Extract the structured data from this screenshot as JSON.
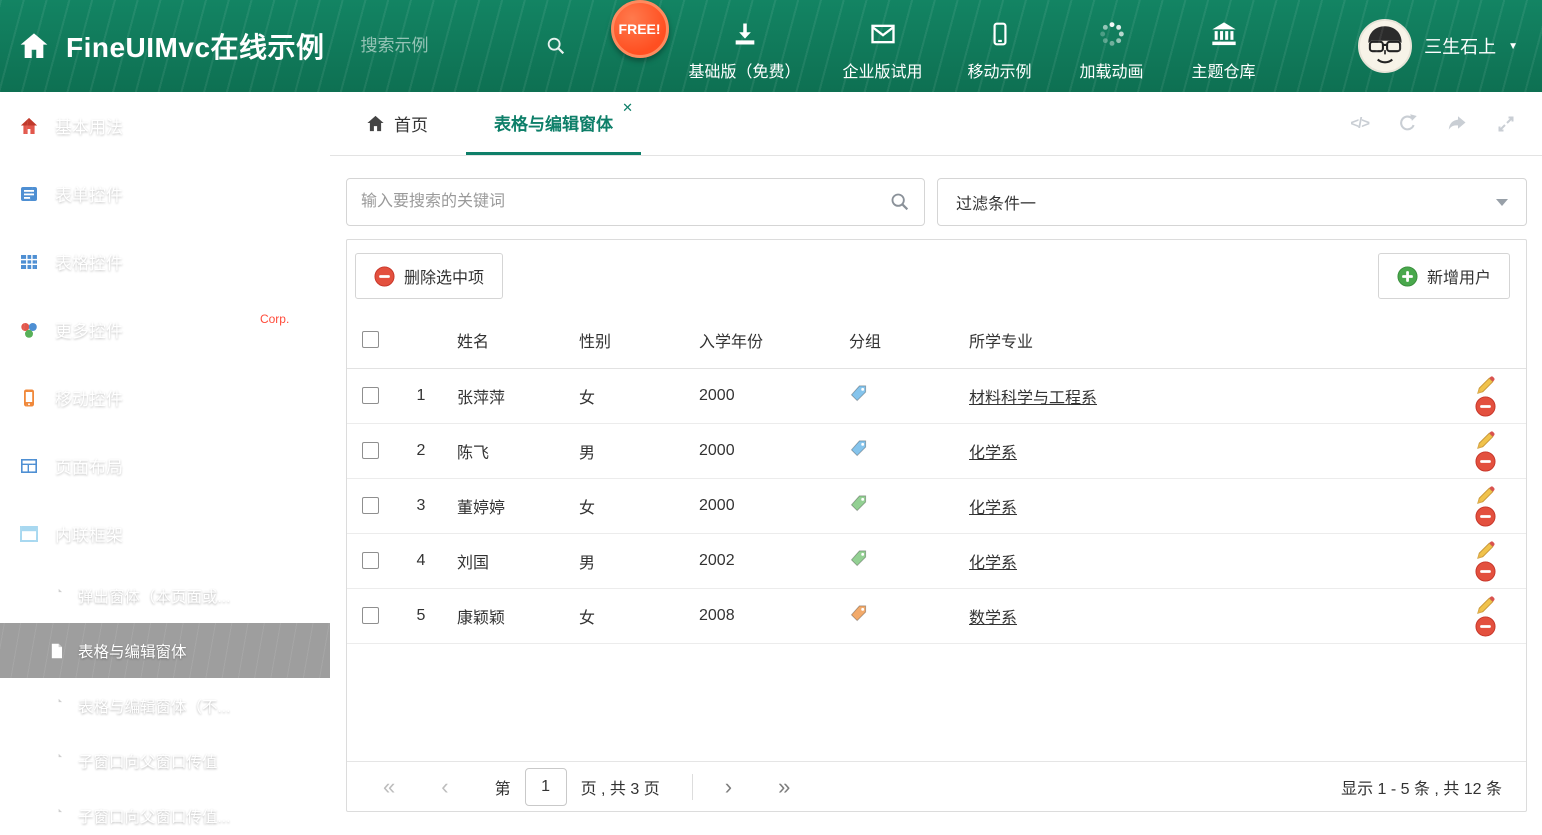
{
  "brand": {
    "title": "FineUIMvc在线示例"
  },
  "header": {
    "search_placeholder": "搜索示例",
    "free_badge": "FREE!",
    "nav": [
      {
        "label": "基础版（免费）",
        "icon": "download-icon"
      },
      {
        "label": "企业版试用",
        "icon": "envelope-icon"
      },
      {
        "label": "移动示例",
        "icon": "mobile-icon"
      },
      {
        "label": "加载动画",
        "icon": "spinner-icon"
      },
      {
        "label": "主题仓库",
        "icon": "bank-icon"
      }
    ],
    "user_name": "三生石上"
  },
  "sidebar": {
    "items": [
      {
        "label": "基本用法"
      },
      {
        "label": "表单控件"
      },
      {
        "label": "表格控件"
      },
      {
        "label": "更多控件"
      },
      {
        "label": "移动控件",
        "badge": "Corp."
      },
      {
        "label": "页面布局"
      },
      {
        "label": "内联框架",
        "children": [
          "弹出窗体（本页面或...",
          "表格与编辑窗体",
          "表格与编辑窗体（不...",
          "子窗口向父窗口传值",
          "子窗口向父窗口传值..."
        ]
      }
    ]
  },
  "tabs": {
    "home": "首页",
    "active": "表格与编辑窗体"
  },
  "filters": {
    "search_placeholder": "输入要搜索的关键词",
    "filter_value": "过滤条件一"
  },
  "toolbar": {
    "delete_label": "删除选中项",
    "add_label": "新增用户"
  },
  "table": {
    "headers": {
      "name": "姓名",
      "gender": "性别",
      "year": "入学年份",
      "group": "分组",
      "major": "所学专业"
    },
    "rows": [
      {
        "num": "1",
        "name": "张萍萍",
        "gender": "女",
        "year": "2000",
        "tag_color": "#85c4ec",
        "major": "材料科学与工程系"
      },
      {
        "num": "2",
        "name": "陈飞",
        "gender": "男",
        "year": "2000",
        "tag_color": "#85c4ec",
        "major": "化学系"
      },
      {
        "num": "3",
        "name": "董婷婷",
        "gender": "女",
        "year": "2000",
        "tag_color": "#93d093",
        "major": "化学系"
      },
      {
        "num": "4",
        "name": "刘国",
        "gender": "男",
        "year": "2002",
        "tag_color": "#93d093",
        "major": "化学系"
      },
      {
        "num": "5",
        "name": "康颖颖",
        "gender": "女",
        "year": "2008",
        "tag_color": "#f2aa6b",
        "major": "数学系"
      }
    ]
  },
  "pagination": {
    "first": "«",
    "prev": "‹",
    "page_prefix": "第",
    "current_page": "1",
    "page_suffix": "页 , 共 3 页",
    "next": "›",
    "last": "»",
    "summary": "显示 1 - 5 条 , 共 12 条"
  },
  "icons": {
    "close": "✕",
    "chevron_right": "▶",
    "chevron_down": "▼",
    "caret_down": "▼",
    "code": "</>"
  },
  "colors": {
    "accent": "#0e7f69",
    "header_bg": "#118063",
    "danger": "#e3503e",
    "success": "#49a84c",
    "free_badge": "#ff4f21",
    "pencil": "#f0c24b"
  }
}
